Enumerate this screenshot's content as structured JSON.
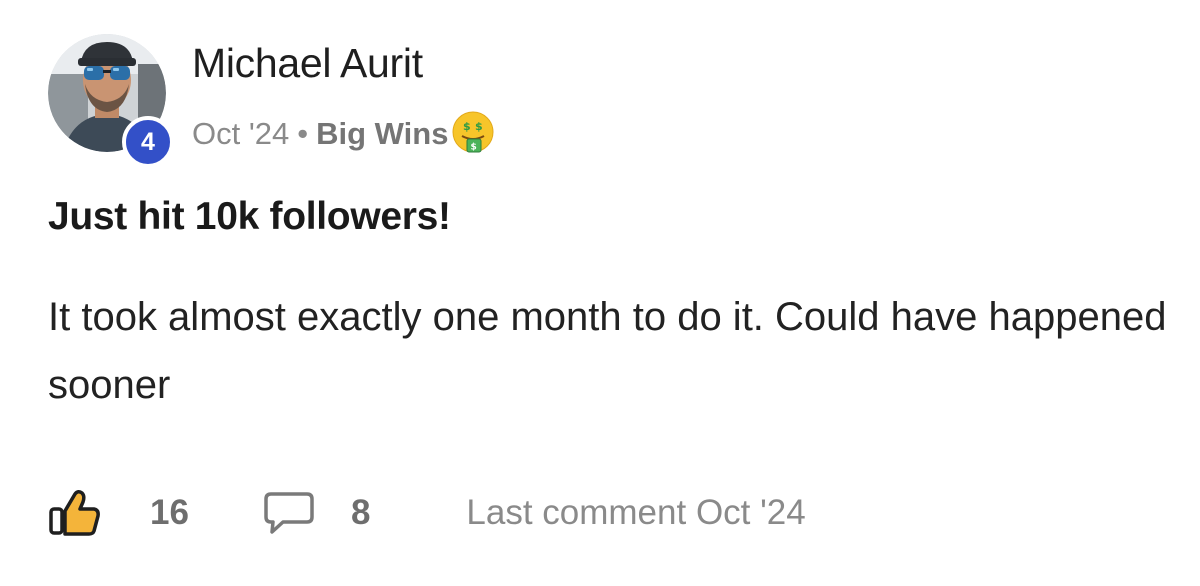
{
  "author": {
    "name": "Michael Aurit",
    "level": "4"
  },
  "meta": {
    "date": "Oct '24",
    "separator": "•",
    "category": "Big Wins",
    "category_emoji": "money-mouth-face-icon"
  },
  "post": {
    "title": "Just hit 10k followers!",
    "body": "It took almost exactly one month to do it. Could have happened sooner"
  },
  "footer": {
    "like_count": "16",
    "comment_count": "8",
    "last_comment": "Last comment Oct '24"
  },
  "colors": {
    "badge": "#3350c8",
    "like_icon_fill": "#f4b43a",
    "emoji_yellow": "#f7c52a"
  }
}
